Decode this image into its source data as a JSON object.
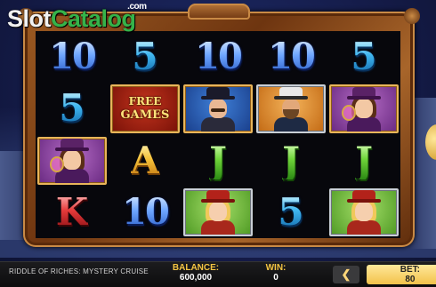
{
  "logo": {
    "slot": "Slot",
    "catalog": "Catalog",
    "com": ".com"
  },
  "reels": [
    [
      {
        "type": "glyph",
        "symbol": "10"
      },
      {
        "type": "glyph",
        "symbol": "5"
      },
      {
        "type": "glyph",
        "symbol": "10"
      },
      {
        "type": "glyph",
        "symbol": "10"
      },
      {
        "type": "glyph",
        "symbol": "5"
      }
    ],
    [
      {
        "type": "glyph",
        "symbol": "5"
      },
      {
        "type": "free",
        "line1": "FREE",
        "line2": "GAMES"
      },
      {
        "type": "pic",
        "symbol": "detective",
        "bg": "blue"
      },
      {
        "type": "pic",
        "symbol": "captain",
        "bg": "orange"
      },
      {
        "type": "pic",
        "symbol": "lady-monocle",
        "bg": "purple"
      }
    ],
    [
      {
        "type": "pic",
        "symbol": "lady-monocle",
        "bg": "purple"
      },
      {
        "type": "glyph",
        "symbol": "A"
      },
      {
        "type": "glyph",
        "symbol": "J"
      },
      {
        "type": "glyph",
        "symbol": "J"
      },
      {
        "type": "glyph",
        "symbol": "J"
      }
    ],
    [
      {
        "type": "glyph",
        "symbol": "K"
      },
      {
        "type": "glyph",
        "symbol": "10"
      },
      {
        "type": "pic",
        "symbol": "blonde-lady",
        "bg": "green"
      },
      {
        "type": "glyph",
        "symbol": "5"
      },
      {
        "type": "pic",
        "symbol": "blonde-lady",
        "bg": "green"
      }
    ]
  ],
  "bottom_bar": {
    "game_title": "RIDDLE OF RICHES: MYSTERY CRUISE",
    "balance_label": "BALANCE:",
    "balance_value": "600,000",
    "win_label": "WIN:",
    "win_value": "0",
    "prev_arrow": "❮",
    "bet_label": "BET:",
    "bet_value": "80"
  },
  "colors": {
    "accent": "#f2c24a",
    "frame": "#9c5a22",
    "logo_green": "#35b34a"
  }
}
